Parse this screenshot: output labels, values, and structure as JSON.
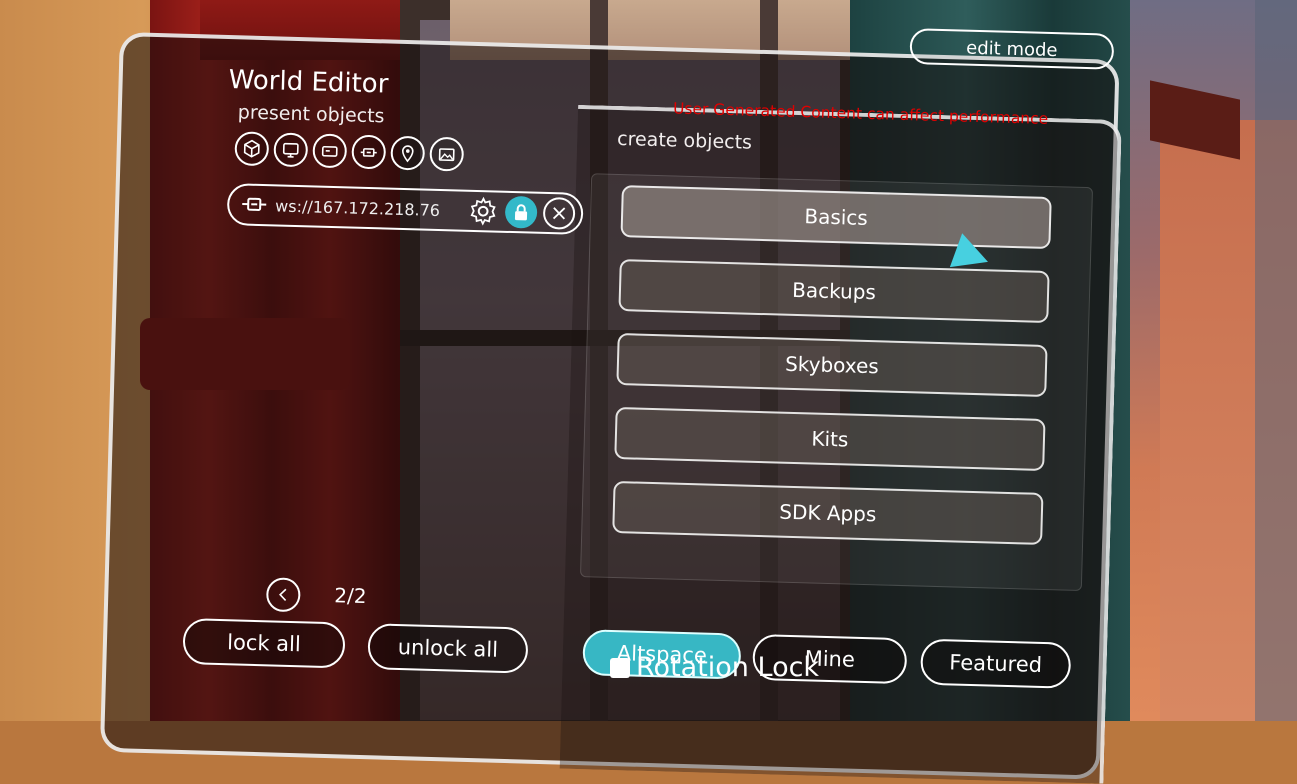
{
  "panel": {
    "title": "World Editor",
    "subtitle": "present objects",
    "edit_mode_label": "edit mode",
    "warning": "User Generated Content can affect performance",
    "create_label": "create objects"
  },
  "present_icons": [
    "cube-icon",
    "monitor-icon",
    "card-icon",
    "plug-icon",
    "location-pin-icon",
    "image-icon"
  ],
  "server": {
    "address": "ws://167.172.218.76"
  },
  "create_objects": [
    "Basics",
    "Backups",
    "Skyboxes",
    "Kits",
    "SDK Apps"
  ],
  "pager": {
    "count": "2/2"
  },
  "actions": {
    "lock_all": "lock all",
    "unlock_all": "unlock all"
  },
  "tabs": [
    {
      "label": "Altspace",
      "active": true
    },
    {
      "label": "Mine",
      "active": false
    },
    {
      "label": "Featured",
      "active": false
    }
  ],
  "rotation_lock_label": "Rotation Lock",
  "colors": {
    "accent": "#37b7c4",
    "warning": "#e00000"
  }
}
